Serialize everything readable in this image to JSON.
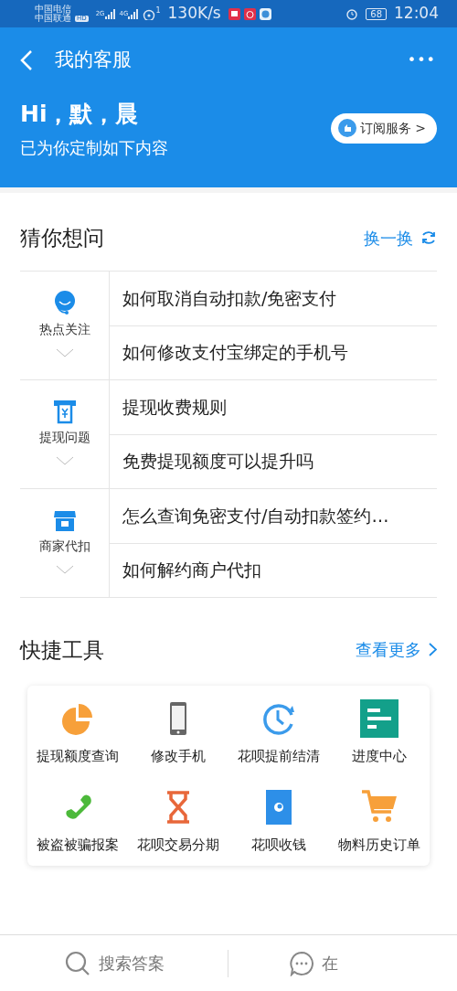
{
  "status_bar": {
    "carrier_1": "中国电信",
    "carrier_2": "中国联通",
    "hd": "HD",
    "net_1": "2G",
    "net_2": "4G",
    "hotspot": "1",
    "speed": "130K/s",
    "battery": "68",
    "time": "12:04"
  },
  "header": {
    "title": "我的客服",
    "more": "•••",
    "greeting": "Hi，默，晨",
    "subtitle": "已为你定制如下内容",
    "subscribe": "订阅服务 >"
  },
  "guess": {
    "title": "猜你想问",
    "refresh": "换一换",
    "groups": [
      {
        "label": "热点关注",
        "expanded": false,
        "questions": [
          "如何取消自动扣款/免密支付",
          "如何修改支付宝绑定的手机号"
        ]
      },
      {
        "label": "提现问题",
        "expanded": false,
        "questions": [
          "提现收费规则",
          "免费提现额度可以提升吗"
        ]
      },
      {
        "label": "商家代扣",
        "expanded": false,
        "questions": [
          "怎么查询免密支付/自动扣款签约…",
          "如何解约商户代扣"
        ]
      }
    ]
  },
  "tools": {
    "title": "快捷工具",
    "more": "查看更多",
    "items": [
      {
        "label": "提现额度查询"
      },
      {
        "label": "修改手机"
      },
      {
        "label": "花呗提前结清"
      },
      {
        "label": "进度中心"
      },
      {
        "label": "被盗被骗报案"
      },
      {
        "label": "花呗交易分期"
      },
      {
        "label": "花呗收钱"
      },
      {
        "label": "物料历史订单"
      }
    ]
  },
  "bottom_bar": {
    "search": "搜索答案",
    "chat": "在"
  }
}
